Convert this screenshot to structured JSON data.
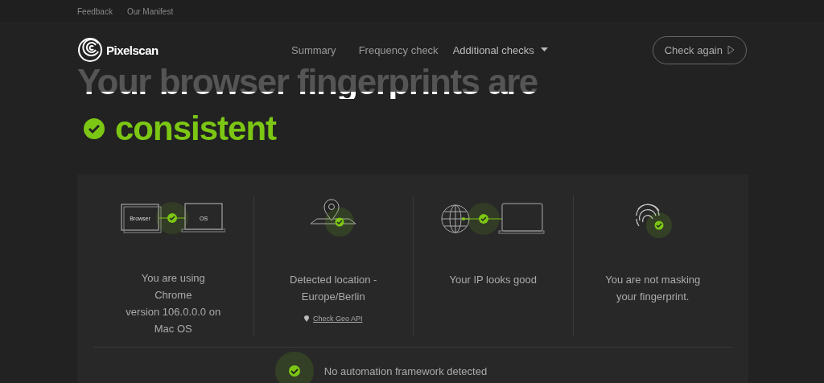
{
  "top_links": [
    "Feedback",
    "Our Manifest"
  ],
  "logo": "Pixelscan",
  "nav": [
    {
      "label": "Summary",
      "dropdown": false
    },
    {
      "label": "Frequency check",
      "dropdown": false
    },
    {
      "label": "Additional checks",
      "dropdown": true
    }
  ],
  "check_again_button": "Check again",
  "headline": "Your browser fingerprints are",
  "verdict": {
    "text": "consistent",
    "passed": true
  },
  "cards": [
    {
      "kind": "browser-os",
      "passed": true,
      "labels": [
        "Browser",
        "OS"
      ],
      "text": "You are using\nChrome\nversion 106.0.0.0 on\nMac OS"
    },
    {
      "kind": "location",
      "passed": true,
      "text": "Detected location -\nEurope/Berlin",
      "link": "Check Geo API"
    },
    {
      "kind": "ip",
      "passed": true,
      "text": "Your IP looks good"
    },
    {
      "kind": "fingerprint",
      "passed": true,
      "text": "You are not masking\nyour fingerprint."
    }
  ],
  "automation": {
    "text": "No automation framework detected",
    "passed": true
  }
}
